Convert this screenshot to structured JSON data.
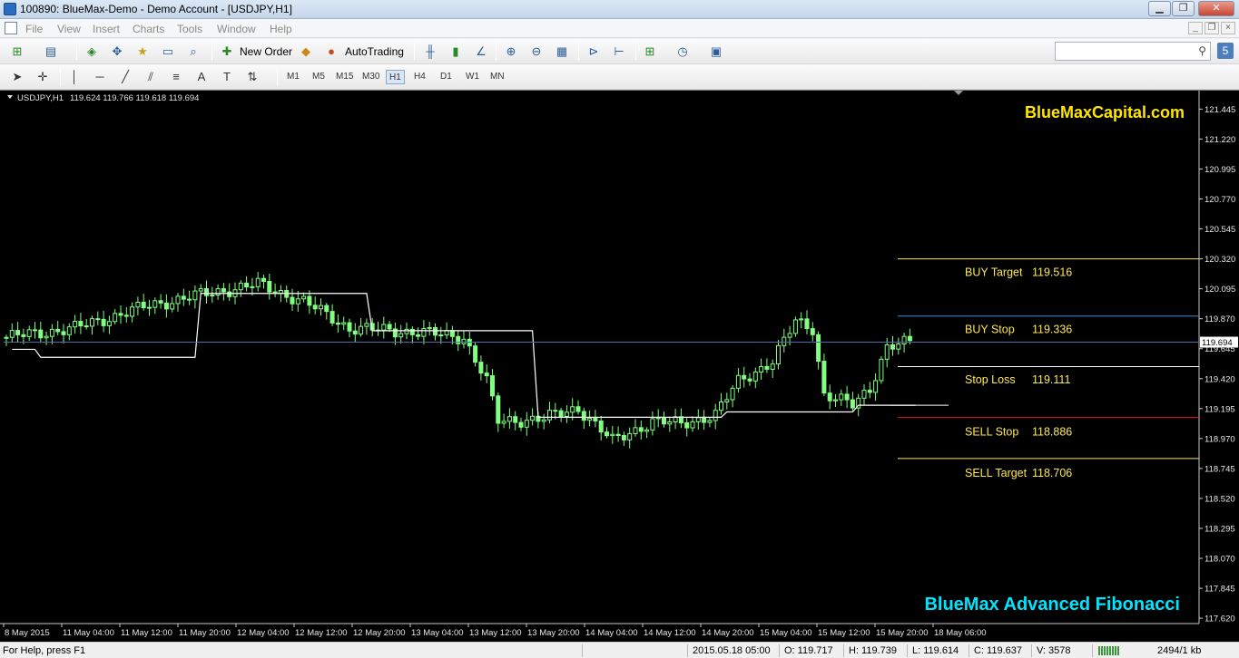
{
  "window": {
    "title": "100890: BlueMax-Demo - Demo Account - [USDJPY,H1]",
    "btn_min": "▁",
    "btn_max": "❐",
    "btn_close": "✕"
  },
  "menu": {
    "items": [
      "File",
      "View",
      "Insert",
      "Charts",
      "Tools",
      "Window",
      "Help"
    ]
  },
  "toolbar": {
    "new_order": "New Order",
    "autotrading": "AutoTrading",
    "timeframes": [
      "M1",
      "M5",
      "M15",
      "M30",
      "H1",
      "H4",
      "D1",
      "W1",
      "MN"
    ],
    "active_timeframe": "H1",
    "icons": [
      "new-chart-icon",
      "profiles-icon",
      "market-watch-icon",
      "navigator-icon",
      "data-window-icon",
      "terminal-icon",
      "strategy-tester-icon",
      "new-order-icon",
      "metaeditor-icon",
      "autotrading-icon",
      "bar-chart-icon",
      "candlesticks-icon",
      "line-chart-icon",
      "zoom-in-icon",
      "zoom-out-icon",
      "tile-windows-icon",
      "auto-scroll-icon",
      "chart-shift-icon",
      "indicators-icon",
      "periods-icon",
      "templates-icon",
      "cursor-icon",
      "crosshair-icon",
      "vertical-line-icon",
      "horizontal-line-icon",
      "trendline-icon",
      "equidistant-channel-icon",
      "fibonacci-icon",
      "text-icon",
      "text-label-icon",
      "arrows-icon"
    ]
  },
  "search": {
    "placeholder": ""
  },
  "chart_data": {
    "type": "candlestick",
    "symbol_header": "USDJPY,H1",
    "ohlc_header": "119.624 119.766 119.618 119.694",
    "brand_top": "BlueMaxCapital.com",
    "brand_bottom": "BlueMax Advanced Fibonacci",
    "current_price": "119.694",
    "ylim": [
      117.58,
      121.57
    ],
    "y_ticks": [
      "121.445",
      "121.220",
      "120.995",
      "120.770",
      "120.545",
      "120.320",
      "120.095",
      "119.870",
      "119.645",
      "119.420",
      "119.195",
      "118.970",
      "118.745",
      "118.520",
      "118.295",
      "118.070",
      "117.845",
      "117.620"
    ],
    "x_ticks": [
      "8 May 2015",
      "11 May 04:00",
      "11 May 12:00",
      "11 May 20:00",
      "12 May 04:00",
      "12 May 12:00",
      "12 May 20:00",
      "13 May 04:00",
      "13 May 12:00",
      "13 May 20:00",
      "14 May 04:00",
      "14 May 12:00",
      "14 May 20:00",
      "15 May 04:00",
      "15 May 12:00",
      "15 May 20:00",
      "18 May 06:00"
    ],
    "levels": [
      {
        "label": "BUY Target",
        "value": "119.516",
        "price": 120.32,
        "color": "#ffe84d",
        "label_price": 120.22
      },
      {
        "label": "BUY Stop",
        "value": "119.336",
        "price": 119.89,
        "color": "#3a8ed8",
        "label_price": 119.79
      },
      {
        "label": "Stop Loss",
        "value": "119.111",
        "price": 119.51,
        "color": "#ffffff",
        "label_price": 119.41
      },
      {
        "label": "SELL Stop",
        "value": "118.886",
        "price": 119.13,
        "color": "#e01818",
        "label_price": 119.02
      },
      {
        "label": "SELL Target",
        "value": "118.706",
        "price": 118.82,
        "color": "#ffe84d",
        "label_price": 118.71
      }
    ],
    "level_extra": {
      "price": 119.22,
      "color": "#ffffff"
    },
    "stepline": [
      [
        1,
        119.64
      ],
      [
        5,
        119.64
      ],
      [
        6,
        119.58
      ],
      [
        33,
        119.58
      ],
      [
        34,
        120.06
      ],
      [
        63,
        120.06
      ],
      [
        64,
        119.78
      ],
      [
        92,
        119.78
      ],
      [
        93,
        119.13
      ],
      [
        125,
        119.13
      ],
      [
        126,
        119.17
      ],
      [
        148,
        119.17
      ],
      [
        149,
        119.22
      ],
      [
        159,
        119.22
      ]
    ],
    "anchors": [
      [
        0,
        119.73
      ],
      [
        12,
        119.8
      ],
      [
        25,
        119.97
      ],
      [
        34,
        120.05
      ],
      [
        44,
        120.13
      ],
      [
        52,
        120.0
      ],
      [
        60,
        119.8
      ],
      [
        72,
        119.77
      ],
      [
        80,
        119.73
      ],
      [
        84,
        119.4
      ],
      [
        86,
        119.1
      ],
      [
        94,
        119.12
      ],
      [
        100,
        119.2
      ],
      [
        106,
        118.95
      ],
      [
        113,
        119.1
      ],
      [
        118,
        119.08
      ],
      [
        124,
        119.15
      ],
      [
        128,
        119.4
      ],
      [
        134,
        119.55
      ],
      [
        138,
        119.85
      ],
      [
        141,
        119.8
      ],
      [
        143,
        119.3
      ],
      [
        148,
        119.22
      ],
      [
        151,
        119.35
      ],
      [
        154,
        119.66
      ],
      [
        158,
        119.69
      ]
    ],
    "bar_count": 159,
    "bar_pixel_step": 6.3
  },
  "status": {
    "help": "For Help, press F1",
    "datetime": "2015.05.18 05:00",
    "open": "O: 119.717",
    "high": "H: 119.739",
    "low": "L: 119.614",
    "close": "C: 119.637",
    "volume": "V: 3578",
    "traffic": "2494/1 kb"
  },
  "colors": {
    "candle": "#80ff80",
    "bid_line": "#4a6fa5",
    "brand_top": "#ffe600",
    "brand_bottom": "#00e5ff",
    "axis": "#c8c8c8"
  }
}
